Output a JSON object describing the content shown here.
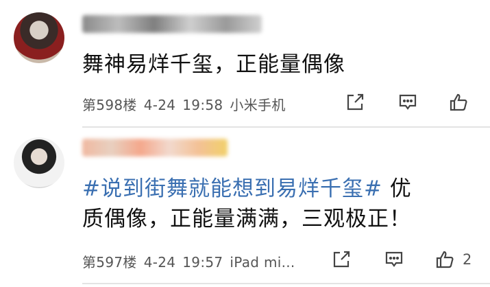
{
  "posts": [
    {
      "text": "舞神易烊千玺，正能量偶像",
      "floor": "第598楼",
      "date": "4-24",
      "time": "19:58",
      "device": "小米手机",
      "like_count": ""
    },
    {
      "hashtag": "#说到街舞就能想到易烊千玺#",
      "text_line1_rest": " 优",
      "text_line2": "质偶像，正能量满满，三观极正！",
      "floor": "第597楼",
      "date": "4-24",
      "time": "19:57",
      "device": "iPad mi...",
      "like_count": "2"
    }
  ],
  "colors": {
    "hashtag": "#3a6fb1",
    "text": "#111111",
    "meta": "#555555"
  },
  "icons": [
    "share-icon",
    "comment-icon",
    "like-icon"
  ]
}
